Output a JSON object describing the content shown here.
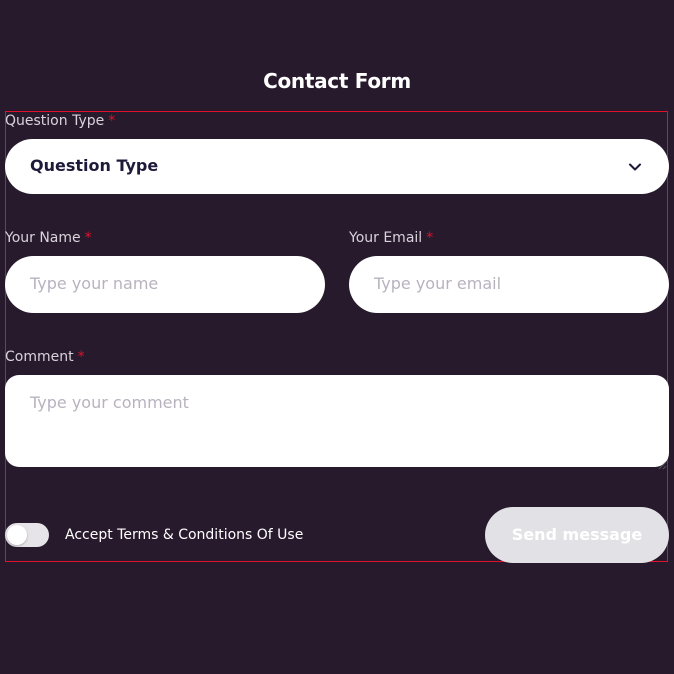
{
  "form": {
    "title": "Contact Form",
    "required_marker": "*",
    "question_type": {
      "label": "Question Type",
      "selected_value": "Question Type",
      "icon": "chevron-down-icon"
    },
    "name": {
      "label": "Your Name",
      "placeholder": "Type your name"
    },
    "email": {
      "label": "Your Email",
      "placeholder": "Type your email"
    },
    "comment": {
      "label": "Comment",
      "placeholder": "Type your comment"
    },
    "terms": {
      "label": "Accept Terms & Conditions Of Use",
      "checked": false
    },
    "submit_label": "Send message"
  },
  "colors": {
    "background": "#271a2c",
    "field_background": "#ffffff",
    "required": "#e0112b",
    "placeholder": "#b8b2bf",
    "button_disabled": "#e2e1e6",
    "outline": "#e0112b"
  }
}
